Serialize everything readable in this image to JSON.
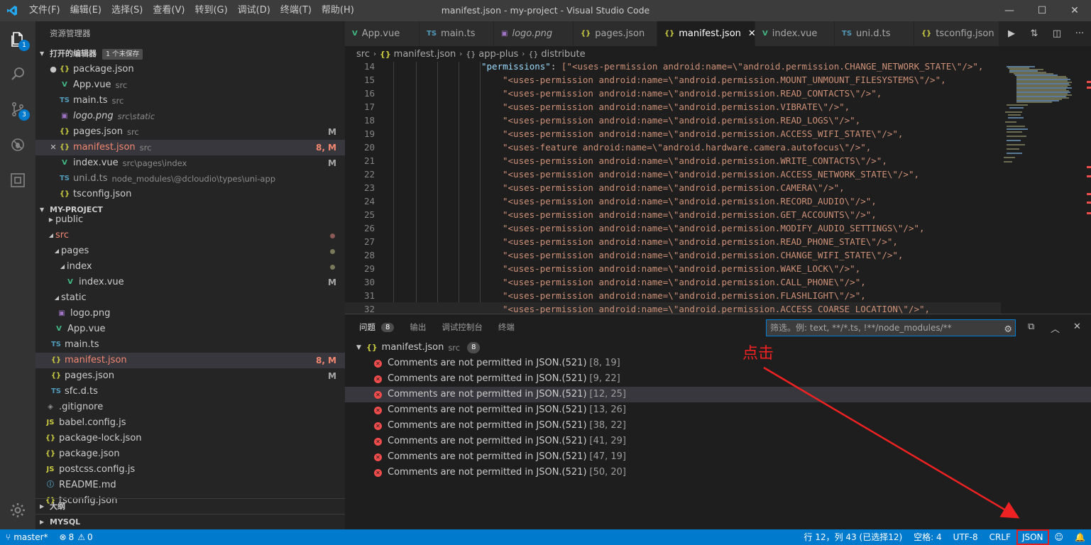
{
  "window": {
    "title": "manifest.json - my-project - Visual Studio Code",
    "menu": [
      "文件(F)",
      "编辑(E)",
      "选择(S)",
      "查看(V)",
      "转到(G)",
      "调试(D)",
      "终端(T)",
      "帮助(H)"
    ],
    "minimize": "—",
    "maximize": "☐",
    "close": "✕"
  },
  "activity": {
    "explorer_badge": "1",
    "scm_badge": "3"
  },
  "sidebar": {
    "title": "资源管理器",
    "open_editors": {
      "header": "打开的编辑器",
      "badge": "1 个未保存",
      "items": [
        {
          "lead": "●",
          "icon": "{}",
          "name": "package.json",
          "desc": "",
          "deco": ""
        },
        {
          "lead": "",
          "icon": "V",
          "name": "App.vue",
          "desc": "src",
          "deco": ""
        },
        {
          "lead": "",
          "icon": "TS",
          "name": "main.ts",
          "desc": "src",
          "deco": ""
        },
        {
          "lead": "",
          "icon": "▣",
          "name": "logo.png",
          "desc": "src\\static",
          "deco": ""
        },
        {
          "lead": "",
          "icon": "{}",
          "name": "pages.json",
          "desc": "src",
          "deco": "M"
        },
        {
          "lead": "✕",
          "icon": "{}",
          "name": "manifest.json",
          "desc": "src",
          "deco": "8, M"
        },
        {
          "lead": "",
          "icon": "V",
          "name": "index.vue",
          "desc": "src\\pages\\index",
          "deco": "M"
        },
        {
          "lead": "",
          "icon": "TS",
          "name": "uni.d.ts",
          "desc": "node_modules\\@dcloudio\\types\\uni-app",
          "deco": ""
        },
        {
          "lead": "",
          "icon": "{}",
          "name": "tsconfig.json",
          "desc": "",
          "deco": ""
        }
      ]
    },
    "project": {
      "header": "MY-PROJECT",
      "items": [
        {
          "name": "public",
          "icon": "",
          "deco": ""
        },
        {
          "name": "src",
          "icon": "",
          "deco": ""
        },
        {
          "name": "pages",
          "icon": "",
          "deco": ""
        },
        {
          "name": "index",
          "icon": "",
          "deco": ""
        },
        {
          "name": "index.vue",
          "icon": "V",
          "deco": "M"
        },
        {
          "name": "static",
          "icon": "",
          "deco": ""
        },
        {
          "name": "logo.png",
          "icon": "▣",
          "deco": ""
        },
        {
          "name": "App.vue",
          "icon": "V",
          "deco": ""
        },
        {
          "name": "main.ts",
          "icon": "TS",
          "deco": ""
        },
        {
          "name": "manifest.json",
          "icon": "{}",
          "deco": "8, M"
        },
        {
          "name": "pages.json",
          "icon": "{}",
          "deco": "M"
        },
        {
          "name": "sfc.d.ts",
          "icon": "TS",
          "deco": ""
        },
        {
          "name": ".gitignore",
          "icon": "◈",
          "deco": ""
        },
        {
          "name": "babel.config.js",
          "icon": "JS",
          "deco": ""
        },
        {
          "name": "package-lock.json",
          "icon": "{}",
          "deco": ""
        },
        {
          "name": "package.json",
          "icon": "{}",
          "deco": ""
        },
        {
          "name": "postcss.config.js",
          "icon": "JS",
          "deco": ""
        },
        {
          "name": "README.md",
          "icon": "ⓘ",
          "deco": ""
        },
        {
          "name": "tsconfig.json",
          "icon": "{}",
          "deco": ""
        }
      ]
    },
    "outline_header": "大纲",
    "mysql_header": "MYSQL"
  },
  "tabs": [
    {
      "icon": "V",
      "label": "App.vue"
    },
    {
      "icon": "TS",
      "label": "main.ts"
    },
    {
      "icon": "▣",
      "label": "logo.png"
    },
    {
      "icon": "{}",
      "label": "pages.json"
    },
    {
      "icon": "{}",
      "label": "manifest.json",
      "close": "✕"
    },
    {
      "icon": "V",
      "label": "index.vue"
    },
    {
      "icon": "TS",
      "label": "uni.d.ts"
    },
    {
      "icon": "{}",
      "label": "tsconfig.json"
    }
  ],
  "breadcrumb": [
    "src",
    "manifest.json",
    "app-plus",
    "distribute"
  ],
  "editor": {
    "lines": [
      {
        "n": "14",
        "key": "\"permissions\"",
        "text": "[\"<uses-permission android:name=\\\"android.permission.CHANGE_NETWORK_STATE\\\"/>\","
      },
      {
        "n": "15",
        "text": "\"<uses-permission android:name=\\\"android.permission.MOUNT_UNMOUNT_FILESYSTEMS\\\"/>\","
      },
      {
        "n": "16",
        "text": "\"<uses-permission android:name=\\\"android.permission.READ_CONTACTS\\\"/>\","
      },
      {
        "n": "17",
        "text": "\"<uses-permission android:name=\\\"android.permission.VIBRATE\\\"/>\","
      },
      {
        "n": "18",
        "text": "\"<uses-permission android:name=\\\"android.permission.READ_LOGS\\\"/>\","
      },
      {
        "n": "19",
        "text": "\"<uses-permission android:name=\\\"android.permission.ACCESS_WIFI_STATE\\\"/>\","
      },
      {
        "n": "20",
        "text": "\"<uses-feature android:name=\\\"android.hardware.camera.autofocus\\\"/>\","
      },
      {
        "n": "21",
        "text": "\"<uses-permission android:name=\\\"android.permission.WRITE_CONTACTS\\\"/>\","
      },
      {
        "n": "22",
        "text": "\"<uses-permission android:name=\\\"android.permission.ACCESS_NETWORK_STATE\\\"/>\","
      },
      {
        "n": "23",
        "text": "\"<uses-permission android:name=\\\"android.permission.CAMERA\\\"/>\","
      },
      {
        "n": "24",
        "text": "\"<uses-permission android:name=\\\"android.permission.RECORD_AUDIO\\\"/>\","
      },
      {
        "n": "25",
        "text": "\"<uses-permission android:name=\\\"android.permission.GET_ACCOUNTS\\\"/>\","
      },
      {
        "n": "26",
        "text": "\"<uses-permission android:name=\\\"android.permission.MODIFY_AUDIO_SETTINGS\\\"/>\","
      },
      {
        "n": "27",
        "text": "\"<uses-permission android:name=\\\"android.permission.READ_PHONE_STATE\\\"/>\","
      },
      {
        "n": "28",
        "text": "\"<uses-permission android:name=\\\"android.permission.CHANGE_WIFI_STATE\\\"/>\","
      },
      {
        "n": "29",
        "text": "\"<uses-permission android:name=\\\"android.permission.WAKE_LOCK\\\"/>\","
      },
      {
        "n": "30",
        "text": "\"<uses-permission android:name=\\\"android.permission.CALL_PHONE\\\"/>\","
      },
      {
        "n": "31",
        "text": "\"<uses-permission android:name=\\\"android.permission.FLASHLIGHT\\\"/>\","
      },
      {
        "n": "32",
        "text": "\"<uses-permission android:name=\\\"android.permission.ACCESS_COARSE_LOCATION\\\"/>\","
      }
    ]
  },
  "panel": {
    "tabs": [
      {
        "label": "问题",
        "badge": "8"
      },
      {
        "label": "输出"
      },
      {
        "label": "调试控制台"
      },
      {
        "label": "终端"
      }
    ],
    "filter_placeholder": "筛选。例: text, **/*.ts, !**/node_modules/**",
    "file": {
      "name": "manifest.json",
      "desc": "src",
      "count": "8"
    },
    "problems": [
      {
        "msg": "Comments are not permitted in JSON.(521)",
        "loc": "[8, 19]"
      },
      {
        "msg": "Comments are not permitted in JSON.(521)",
        "loc": "[9, 22]"
      },
      {
        "msg": "Comments are not permitted in JSON.(521)",
        "loc": "[12, 25]"
      },
      {
        "msg": "Comments are not permitted in JSON.(521)",
        "loc": "[13, 26]"
      },
      {
        "msg": "Comments are not permitted in JSON.(521)",
        "loc": "[38, 22]"
      },
      {
        "msg": "Comments are not permitted in JSON.(521)",
        "loc": "[41, 29]"
      },
      {
        "msg": "Comments are not permitted in JSON.(521)",
        "loc": "[47, 19]"
      },
      {
        "msg": "Comments are not permitted in JSON.(521)",
        "loc": "[50, 20]"
      }
    ]
  },
  "annotation": {
    "text": "点击",
    "color": "#ee2222"
  },
  "statusbar": {
    "branch": "master*",
    "errors": "8",
    "warnings": "0",
    "position": "行 12，列 43 (已选择12)",
    "spaces": "空格: 4",
    "encoding": "UTF-8",
    "eol": "CRLF",
    "language": "JSON"
  },
  "colors": {
    "accent": "#007acc",
    "error": "#f14c4c",
    "modified_error": "#f48771"
  }
}
